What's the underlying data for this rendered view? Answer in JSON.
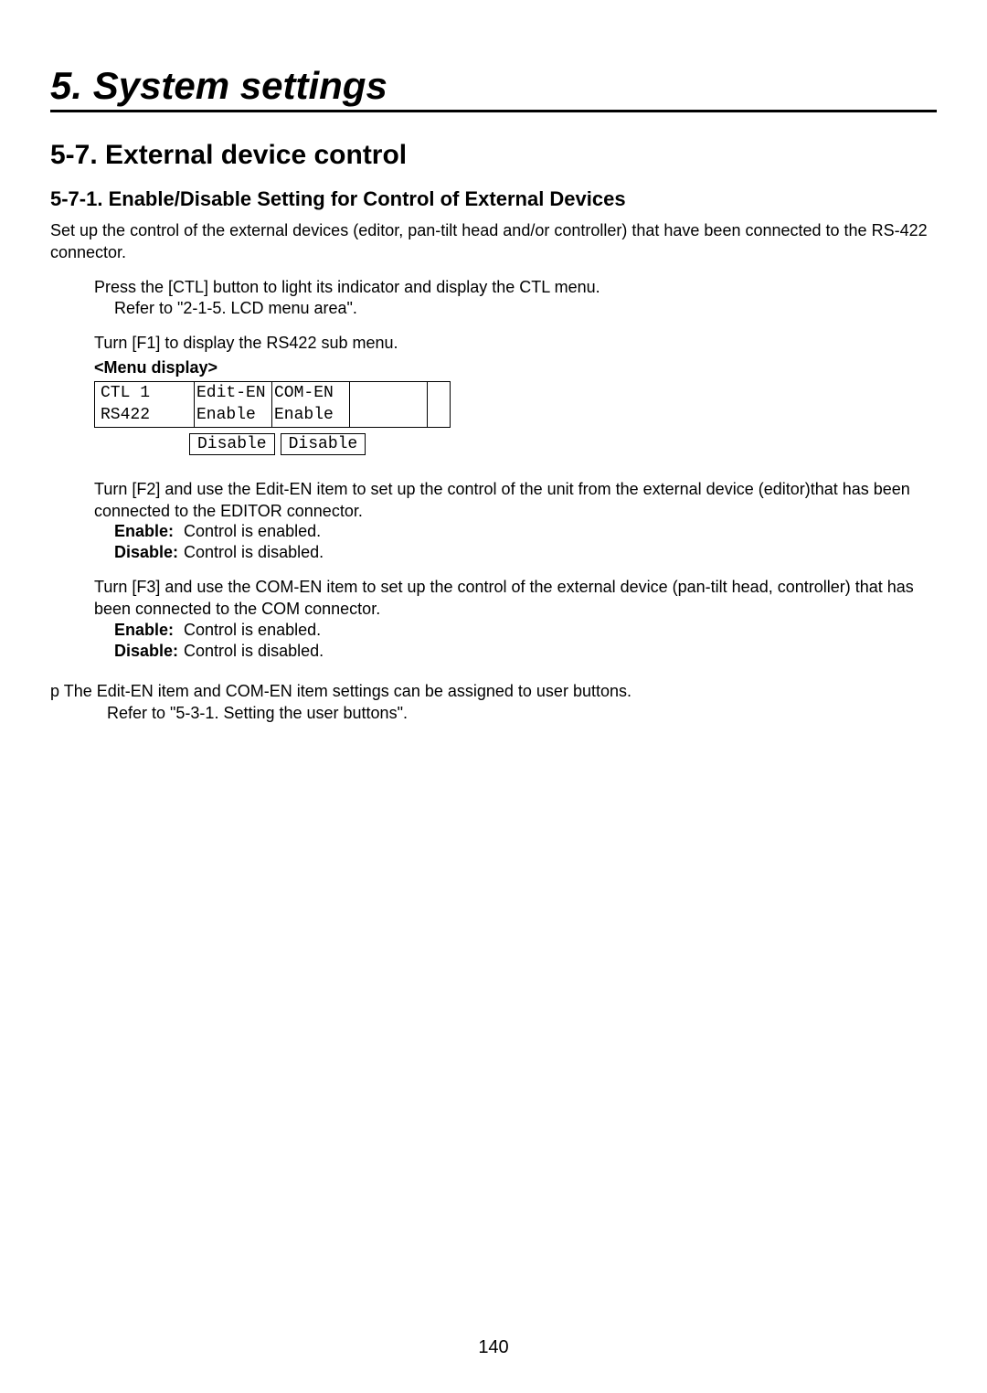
{
  "chapter": "5. System settings",
  "section": "5-7. External device control",
  "subsection": "5-7-1. Enable/Disable Setting for Control of External Devices",
  "intro": "Set up the control of the external devices (editor, pan-tilt head and/or controller) that have been connected to the RS-422 connector.",
  "step1_line1": "Press the [CTL] button to light its indicator and display the CTL menu.",
  "step1_line2": "Refer to \"2-1-5. LCD menu area\".",
  "step2": "Turn [F1] to display the RS422 sub menu.",
  "menu_label": "<Menu display>",
  "lcd": {
    "row1": {
      "a": "CTL   1",
      "b": "Edit-EN",
      "c": "COM-EN",
      "d": "",
      "e": ""
    },
    "row2": {
      "a": "RS422",
      "b": "Enable",
      "c": "Enable",
      "d": "",
      "e": ""
    },
    "alt": {
      "b": "Disable",
      "c": "Disable"
    }
  },
  "f2_text": "Turn [F2] and use the Edit-EN item to set up the control of the unit from the external device (editor)that has been connected to the EDITOR connector.",
  "f3_text": "Turn [F3] and use the COM-EN item to set up the control of the external device (pan-tilt head, controller) that has been connected to the COM connector.",
  "defs": {
    "enable_term": "Enable:",
    "enable_text": "Control is enabled.",
    "disable_term": "Disable:",
    "disable_text": "Control is disabled."
  },
  "note": {
    "mark": "p",
    "line1": "The Edit-EN item and COM-EN item settings can be assigned to user buttons.",
    "line2": "Refer to \"5-3-1. Setting the user buttons\"."
  },
  "page_number": "140"
}
